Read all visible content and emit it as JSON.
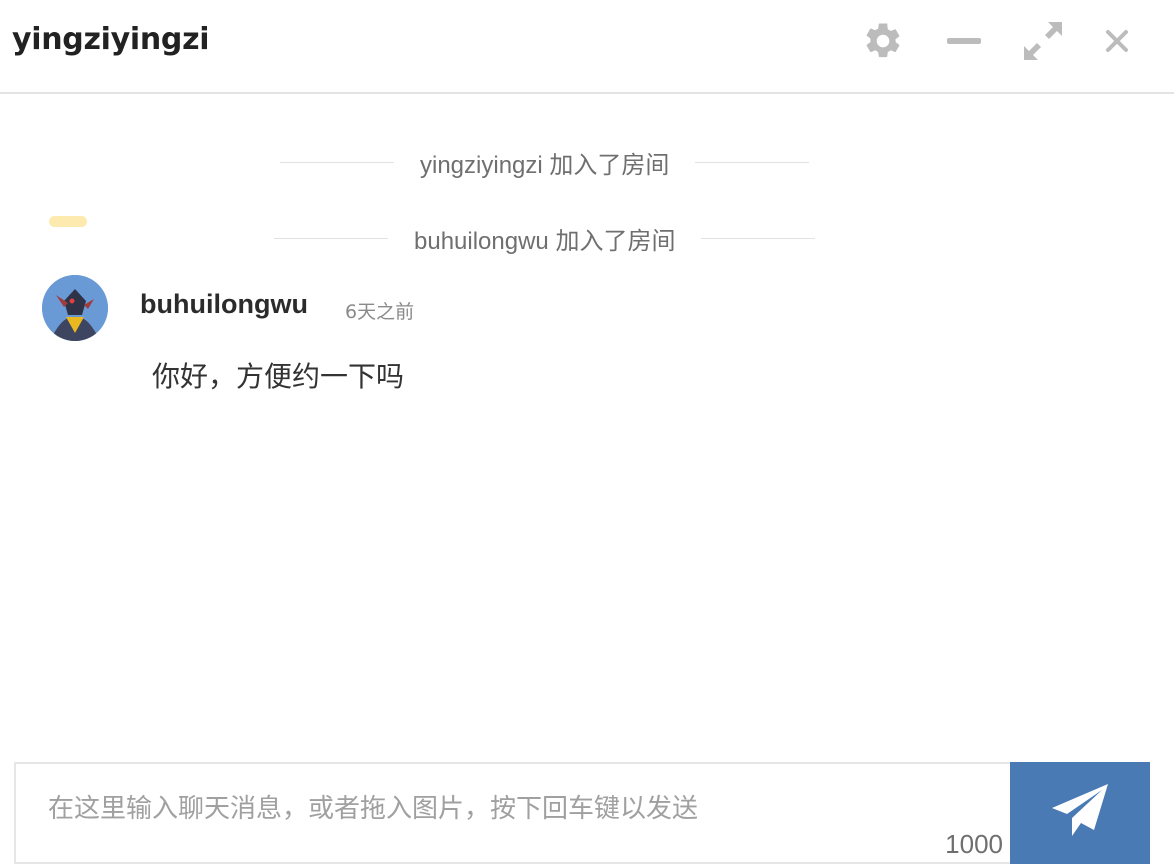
{
  "header": {
    "title": "yingziyingzi",
    "controls": {
      "settings_icon": "gear-icon",
      "minimize_icon": "minimize-icon",
      "maximize_icon": "expand-icon",
      "close_icon": "close-icon",
      "icon_color": "#bcbcbc"
    }
  },
  "chat": {
    "system_messages": [
      {
        "text": "yingziyingzi 加入了房间"
      },
      {
        "text": "buhuilongwu 加入了房间"
      }
    ],
    "messages": [
      {
        "sender": "buhuilongwu",
        "time": "6天之前",
        "content": "你好，方便约一下吗",
        "avatar": "avatar-image"
      }
    ]
  },
  "composer": {
    "placeholder": "在这里输入聊天消息，或者拖入图片，按下回车键以发送",
    "value": "",
    "char_counter": "1000",
    "send_icon": "paper-plane-icon",
    "send_color": "#4a7ab4"
  }
}
